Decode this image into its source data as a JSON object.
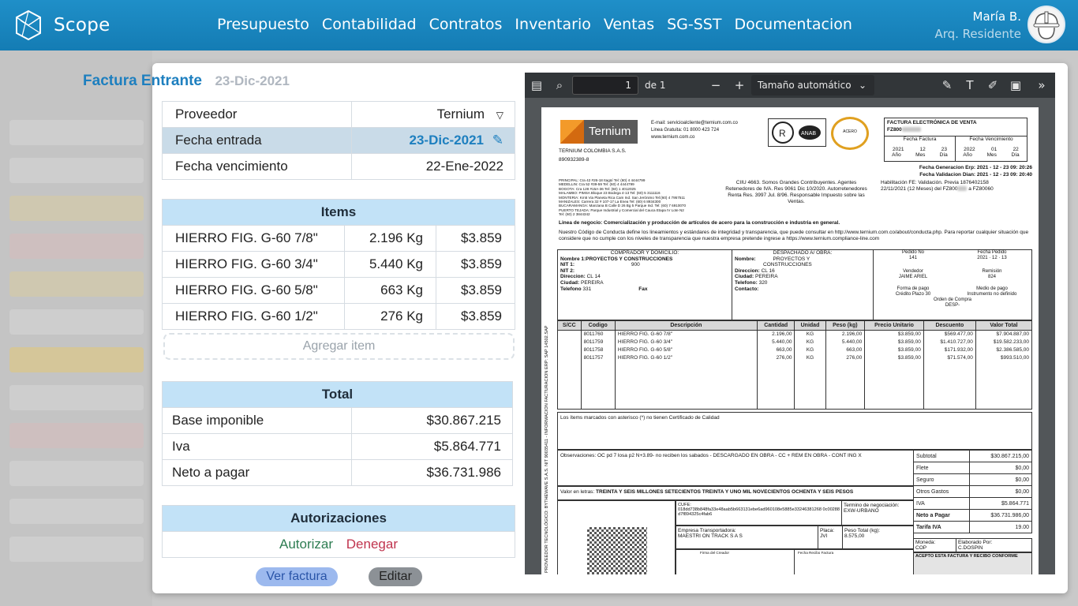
{
  "app": {
    "name": "Scope"
  },
  "nav": [
    "Presupuesto",
    "Contabilidad",
    "Contratos",
    "Inventario",
    "Ventas",
    "SG-SST",
    "Documentacion"
  ],
  "user": {
    "name": "María B.",
    "role": "Arq. Residente"
  },
  "invoice": {
    "title": "Factura Entrante",
    "date": "23-Dic-2021",
    "fields": [
      {
        "label": "Proveedor",
        "value": "Ternium"
      },
      {
        "label": "Fecha entrada",
        "value": "23-Dic-2021"
      },
      {
        "label": "Fecha vencimiento",
        "value": "22-Ene-2022"
      }
    ]
  },
  "items": {
    "title": "Items",
    "rows": [
      {
        "name": "HIERRO FIG. G-60 7/8\"",
        "qty": "2.196 Kg",
        "price": "$3.859"
      },
      {
        "name": "HIERRO FIG. G-60 3/4\"",
        "qty": "5.440 Kg",
        "price": "$3.859"
      },
      {
        "name": "HIERRO FIG. G-60 5/8\"",
        "qty": "663 Kg",
        "price": "$3.859"
      },
      {
        "name": "HIERRO FIG. G-60 1/2\"",
        "qty": "276 Kg",
        "price": "$3.859"
      }
    ],
    "add_label": "Agregar item"
  },
  "total": {
    "title": "Total",
    "rows": [
      {
        "label": "Base imponible",
        "value": "$30.867.215"
      },
      {
        "label": "Iva",
        "value": "$5.864.771"
      },
      {
        "label": "Neto a pagar",
        "value": "$36.731.986"
      }
    ]
  },
  "auth": {
    "title": "Autorizaciones",
    "approve": "Autorizar",
    "deny": "Denegar"
  },
  "buttons": {
    "view": "Ver factura",
    "edit": "Editar"
  },
  "viewer": {
    "page": "1",
    "of_label": "de 1",
    "zoom": "Tamaño automático"
  },
  "pdf": {
    "company": "TERNIUM COLOMBIA S.A.S.",
    "nit": "890932389-8",
    "logo_text": "Ternium",
    "contact": [
      "E-mail: servicioalcliente@ternium.com.co",
      "Linea Gratuita: 01 8000 423 724",
      "www.ternium.com.co"
    ],
    "doc_title": "FACTURA ELECTRÓNICA DE VENTA",
    "doc_num": "FZ800",
    "fecha_factura": "Fecha Factura",
    "fecha_venc": "Fecha Vencimiento",
    "ff": [
      "2021",
      "12",
      "23"
    ],
    "fv": [
      "2022",
      "01",
      "22"
    ],
    "ymd": [
      "Año",
      "Mes",
      "Día"
    ],
    "gen": "Fecha Generacion Erp: 2021 - 12 - 23 09: 20:26",
    "val": "Fecha Validacion Dian: 2021 - 12 - 23 09: 20:40",
    "ciiu": "CIIU 4663. Somos Grandes Contribuyentes. Agentes Retenedores de IVA. Res 9061 Dic 10/2020. Autorretenedores Renta Res. 3997 Jul. 8/96. Responsable Impuesto sobre las Ventas.",
    "habil": "Habilitación FE: Validación. Previa 1876402158",
    "habil2": "22/11/2021 (12 Meses) del FZ800",
    "habil2b": "a FZ80060",
    "branches": "PRINCIPAL: Cra 42 #26-18 Itagüí Tel: (60) 4 4444799\nMEDELLIN: Cra 52 #39-59 Tel: (60) 4 4444799\nBOGOTA: Cra 128 #15A-36 Tel: (60) 1 4012025\nMALAMBO: PIMSA Bloque 23 Bodega 4-13 Tel: (60) 5 3111116\nMONTERIA: Km5 Via Planeta Rica Cam Ind. San Jerónimo Tel:(60) 4 7957511\nMANIZALES: Carrera 32 # 107-17 La Enea Tel: (60) 6 8934300\nBUCARAMANGA: Manzana B Calle D 26 Bg 5 Parque Ind. Tel: (60) 7 6910070\nPUERTO TEJADA: Parque Industrial y Comercial del Cauca Etapa IV Lote N2\nTel: (60) 2 3844342",
    "line_business": "Linea de negocio: Comercialización y producción de artículos de acero para la construcción e industria en general.",
    "conduct": "Nuestro Código de Conducta define los lineamientos y estándares de integridad y transparencia, que puede consultar en http://www.ternium.com.co/about/conducta.php. Para reportar cualquier situación que considere que no cumple con los niveles de transparencia que nuestra empresa pretende ingrese a https://www.ternium.compliance-line.com",
    "buyer_h": "COMPRADOR Y DOMICILIO:",
    "buyer": [
      "Nombre 1:PROYECTOS Y CONSTRUCCIONES",
      "NIT 1:",
      "NIT 2:",
      "Direccion:",
      "Ciudad:",
      "Telefono"
    ],
    "buyer_v": [
      "",
      "900",
      "",
      "CL 14",
      "PEREIRA",
      "331"
    ],
    "fax": "Fax",
    "ship_h": "DESPACHADO A/ OBRA:",
    "ship": [
      "Nombre:",
      "",
      "Direccion:",
      "Ciudad:",
      "Telefono:",
      "Contacto:"
    ],
    "ship_v": [
      "PROYECTOS Y",
      "CONSTRUCCIONES",
      "CL 16",
      "PEREIRA",
      "320",
      ""
    ],
    "pedido_h": "Pedido No",
    "pedido": "141",
    "fped_h": "Fecha Pedido",
    "fped": [
      "2021",
      "12",
      "13"
    ],
    "vend_h": "Vendedor",
    "vend": "JAIME ARIEL",
    "rem_h": "Remisión",
    "rem": "824",
    "pago_h": "Forma de pago",
    "pago": "Crédito Plazo 30",
    "medio_h": "Medio de pago",
    "medio": "Instrumento no definido",
    "orden_h": "Orden de Compra",
    "orden": "DESP-",
    "cols": [
      "S/CC",
      "Codigo",
      "Descripción",
      "Cantidad",
      "Unidad",
      "Peso (kg)",
      "Precio Unitario",
      "Descuento",
      "Valor Total"
    ],
    "lines": [
      [
        "",
        "8011760",
        "HIERRO FIG. G-60 7/8\"",
        "2.196,00",
        "KG",
        "2.196,00",
        "$3.859,00",
        "$569.477,00",
        "$7.904.887,00"
      ],
      [
        "",
        "8011759",
        "HIERRO FIG. G-60 3/4\"",
        "5.440,00",
        "KG",
        "5.440,00",
        "$3.859,00",
        "$1.410.727,00",
        "$19.582.233,00"
      ],
      [
        "",
        "8011758",
        "HIERRO FIG. G-60 5/8\"",
        "663,00",
        "KG",
        "663,00",
        "$3.859,00",
        "$171.932,00",
        "$2.386.585,00"
      ],
      [
        "",
        "8011757",
        "HIERRO FIG. G-60 1/2\"",
        "276,00",
        "KG",
        "276,00",
        "$3.859,00",
        "$71.574,00",
        "$993.510,00"
      ]
    ],
    "asterisk": "Los ítems marcados con asterisco (*) no tienen Certificado de Calidad",
    "obs": "Observaciones:  OC pd 7 losa p2 N+3.89-  no reciben los sabados  - DESCARGADO EN OBRA  - CC + REM EN OBRA  -  CONT ING X",
    "letters_label": "Valor en letras:",
    "letters": "TREINTA Y SEIS MILLONES  SETECIENTOS TREINTA Y UNO MIL NOVECIENTOS OCHENTA Y SEIS PESOS",
    "cufe_h": "CUFE:",
    "cufe": "018dd738b848fa33e48aab5b663131ebe6ad960108e5885e33246381268 0c00288d7f894325c4fab6",
    "term_h": "Termino de negociación:",
    "term": "EXW-URBANO",
    "transp_h": "Empresa Transportadora:",
    "transp": "MAESTRI ON TRACK S A S",
    "placa_h": "Placa:",
    "placa": "JVI",
    "peso_h": "Peso Total (kg):",
    "peso": "8.575,00",
    "firma1": "Firma del Creador",
    "firma2": "Fecha Recibo Factura",
    "sums": [
      [
        "Subtotal",
        "$30.867.215,00"
      ],
      [
        "Flete",
        "$0,00"
      ],
      [
        "Seguro",
        "$0,00"
      ],
      [
        "Otros Gastos",
        "$0,00"
      ],
      [
        "IVA",
        "$5.864.771"
      ],
      [
        "Neto a Pagar",
        "$36.731.986,00"
      ],
      [
        "Tarifa IVA",
        "19.00"
      ]
    ],
    "moneda_h": "Moneda:",
    "moneda": "COP",
    "elab_h": "Elaborado Por:",
    "elab": "C.DOSPIN",
    "accept": "ACEPTO ESTA FACTURA Y RECIBO CONFORME",
    "side": "PROVEEDOR TECNOLÓGICO: BYTHEWAVE S.A.S. NIT 90035411 - INFORMACION FACTURACION ERP: SAP  14502.SAP"
  }
}
